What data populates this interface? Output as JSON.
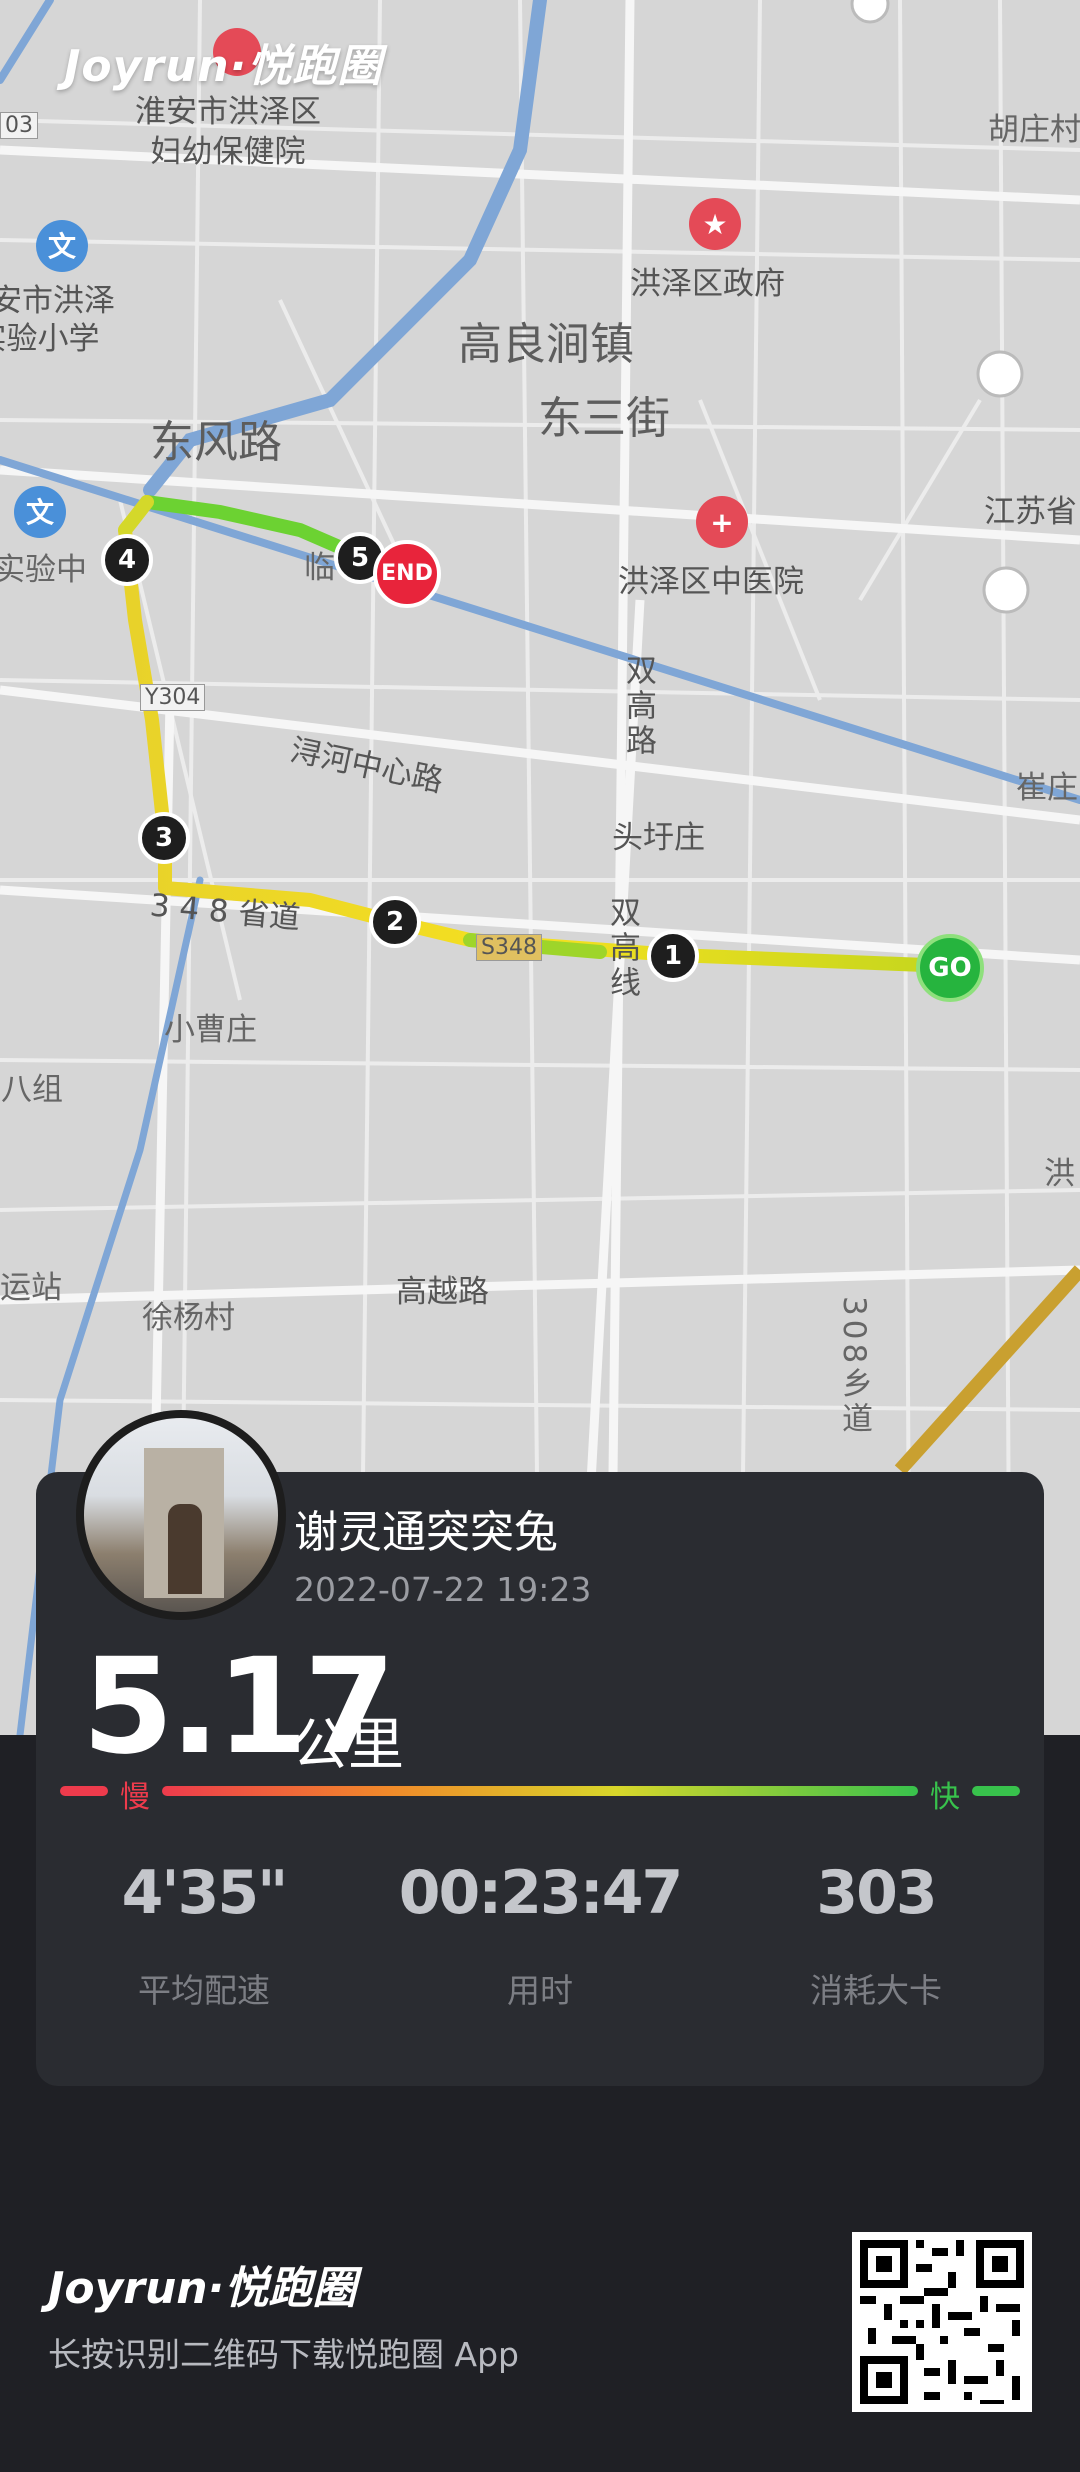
{
  "brand": {
    "top": "Joyrun·悦跑圈",
    "bottom": "Joyrun·悦跑圈",
    "tagline": "长按识别二维码下载悦跑圈 App"
  },
  "map": {
    "labels": {
      "hospital_women": "淮安市洪泽区\n妇幼保健院",
      "school": "淮安市洪泽\n实验小学",
      "gov": "洪泽区政府",
      "town": "高良涧镇",
      "street3": "东三街",
      "dongfeng": "东风路",
      "tcm": "洪泽区中医院",
      "jiangsu": "江苏省",
      "xunhe": "浔河中心路",
      "shuanggao": "双高路",
      "touyu": "头圩庄",
      "provincial": "3 4 8 省道",
      "xiaocao": "小曹庄",
      "baozu": "马八组",
      "shuanggaoxian": "双高线",
      "station": "运站",
      "xuyang": "徐杨村",
      "gaoyue": "高越路",
      "road308": "308乡道",
      "huzhuang": "胡庄村",
      "cuizhuang": "崔庄",
      "hong": "洪",
      "y304": "Y304",
      "s348": "S348",
      "r03": "03",
      "school2": "实验中",
      "lin": "临"
    },
    "markers": [
      "1",
      "2",
      "3",
      "4",
      "5"
    ],
    "end_label": "END",
    "go_label": "GO"
  },
  "user": {
    "name": "谢灵通突突兔",
    "datetime": "2022-07-22 19:23"
  },
  "run": {
    "distance": "5.17",
    "distance_unit": "公里",
    "slow_label": "慢",
    "fast_label": "快",
    "stats": [
      {
        "value": "4'35\"",
        "label": "平均配速"
      },
      {
        "value": "00:23:47",
        "label": "用时"
      },
      {
        "value": "303",
        "label": "消耗大卡"
      }
    ]
  },
  "colors": {
    "slow": "#ee3b4c",
    "fast": "#38c24c",
    "card_bg": "#2a2c31",
    "page_bg": "#1f2025"
  }
}
